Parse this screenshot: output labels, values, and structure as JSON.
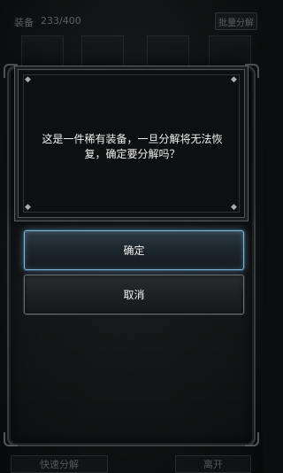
{
  "background": {
    "inventory_label": "装备",
    "inventory_count": "233/400",
    "batch_decompose_label": "批量分解",
    "quick_decompose_label": "快速分解",
    "leave_label": "离开"
  },
  "dialog": {
    "message": "这是一件稀有装备，一旦分解将无法恢复，确定要分解吗？",
    "confirm_label": "确定",
    "cancel_label": "取消"
  },
  "colors": {
    "confirm_border": "#7fb7d8",
    "cancel_border": "#6a6f73",
    "dialog_background": "#0d0f10"
  }
}
